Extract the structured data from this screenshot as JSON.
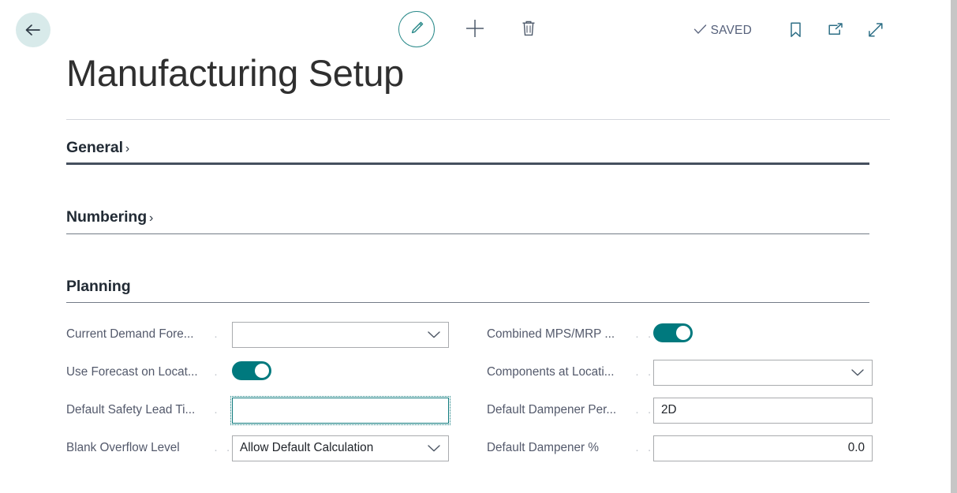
{
  "toolbar": {
    "back_label": "Back",
    "edit_label": "Edit",
    "new_label": "New",
    "delete_label": "Delete",
    "saved_text": "SAVED",
    "bookmark_label": "Bookmark",
    "open_new_window_label": "Open in new window",
    "expand_label": "Expand",
    "accent_color": "#2a8a8a",
    "back_circle_color": "#d8eaea",
    "saved_text_color": "#56617b"
  },
  "page_title": "Manufacturing Setup",
  "sections": [
    {
      "title": "General",
      "chevron": "›",
      "expanded": false,
      "rule": "thick"
    },
    {
      "title": "Numbering",
      "chevron": "›",
      "expanded": false,
      "rule": "thin"
    },
    {
      "title": "Planning",
      "chevron": "",
      "expanded": true,
      "rule": "thin"
    }
  ],
  "planning": {
    "left_column": [
      {
        "label": "Current Demand Fore...",
        "leader": "·",
        "control": "dropdown",
        "value": "",
        "focused": false,
        "name": "current-demand-forecast"
      },
      {
        "label": "Use Forecast on Locat...",
        "leader": "·",
        "control": "toggle",
        "value": "on",
        "focused": false,
        "name": "use-forecast-on-locations"
      },
      {
        "label": "Default Safety Lead Ti...",
        "leader": "·",
        "control": "text",
        "value": "",
        "focused": true,
        "name": "default-safety-lead-time"
      },
      {
        "label": "Blank Overflow Level",
        "leader": "· · · ·",
        "control": "dropdown",
        "value": "Allow Default Calculation",
        "focused": false,
        "name": "blank-overflow-level"
      }
    ],
    "right_column": [
      {
        "label": "Combined MPS/MRP ...",
        "leader": "· ·",
        "control": "toggle",
        "value": "on",
        "focused": false,
        "name": "combined-mps-mrp-calculation"
      },
      {
        "label": "Components at Locati...",
        "leader": "· ·",
        "control": "dropdown",
        "value": "",
        "focused": false,
        "name": "components-at-location"
      },
      {
        "label": "Default Dampener Per...",
        "leader": "· ·",
        "control": "text",
        "value": "2D",
        "align": "left",
        "focused": false,
        "name": "default-dampener-period"
      },
      {
        "label": "Default Dampener %",
        "leader": "· · · ·",
        "control": "text",
        "value": "0.0",
        "align": "right",
        "focused": false,
        "name": "default-dampener-percent"
      }
    ]
  },
  "colors": {
    "toggle_on": "#00797e",
    "focus_border": "#0e7a7d",
    "section_rule_active": "#454f5e",
    "label_text": "#53596b"
  }
}
